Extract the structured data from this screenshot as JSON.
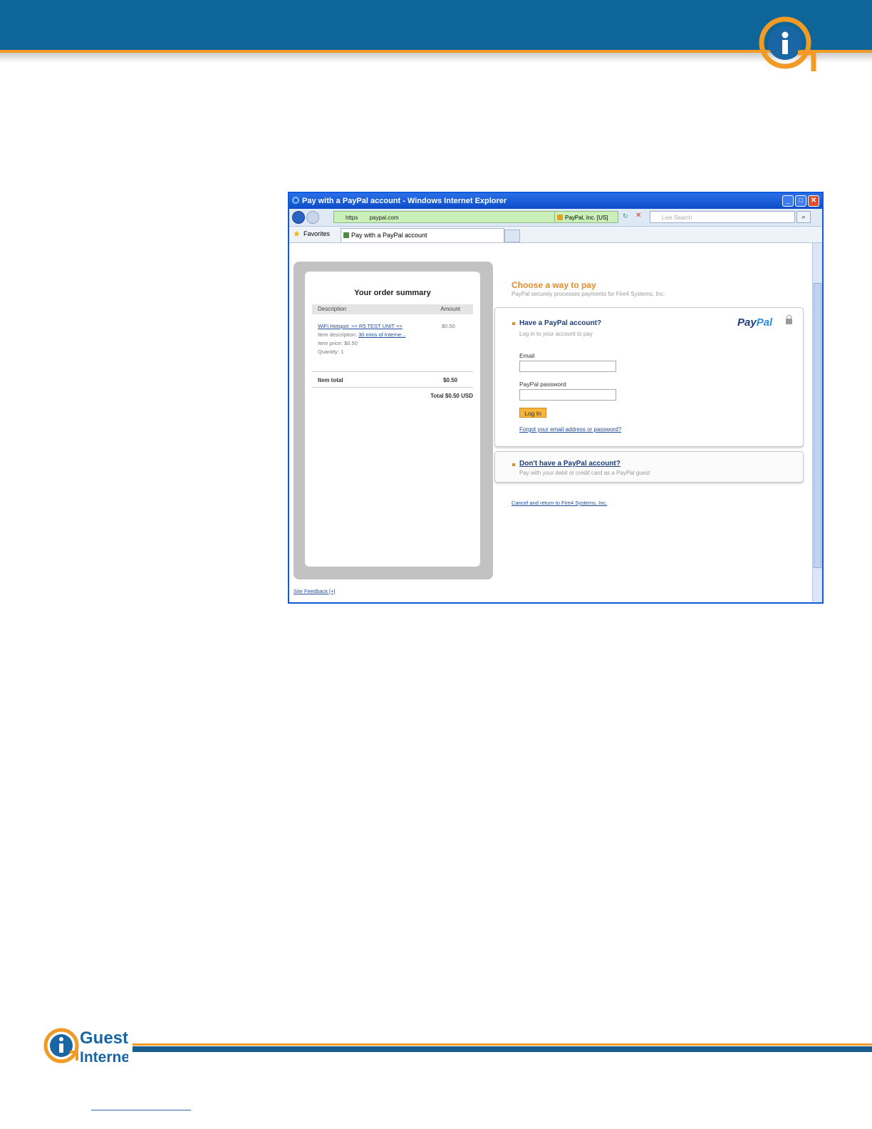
{
  "browser": {
    "window_title": "Pay with a PayPal account - Windows Internet Explorer",
    "address_prefix": "https",
    "address_domain": "paypal.com",
    "certificate": "PayPal, Inc. [US]",
    "search_placeholder": "Live Search",
    "favorites_label": "Favorites",
    "tab_label": "Pay with a PayPal account"
  },
  "order": {
    "title": "Your order summary",
    "col_description": "Description",
    "col_amount": "Amount",
    "item_name": "WiFi Hotspot: >> R5 TEST UNIT <<",
    "item_description_label": "Item description:",
    "item_description_value": "30 mins of Interne...",
    "item_price": "Item price: $0.50",
    "quantity": "Quantity: 1",
    "item_amount": "$0.50",
    "items_total_label": "Item total",
    "items_total_value": "$0.50",
    "grand_total": "Total $0.50 USD"
  },
  "payment": {
    "heading": "Choose a way to pay",
    "subheading": "PayPal securely processes payments for Fire4 Systems, Inc.",
    "have_account": "Have a PayPal account?",
    "have_account_sub": "Log in to your account to pay",
    "email_label": "Email",
    "password_label": "PayPal password",
    "login_button": "Log In",
    "forgot_link": "Forgot your email address or password?",
    "logo_part1": "Pay",
    "logo_part2": "Pal",
    "no_account": "Don't have a PayPal account?",
    "no_account_sub": "Pay with your debit or credit card as a PayPal guest",
    "cancel_link": "Cancel and return to Fire4 Systems, Inc.",
    "site_feedback": "Site Feedback [+]"
  },
  "footer": {
    "brand_line1": "Guest",
    "brand_line2": "Internet"
  },
  "colors": {
    "header_blue": "#0e6597",
    "accent_orange": "#f19a26"
  }
}
